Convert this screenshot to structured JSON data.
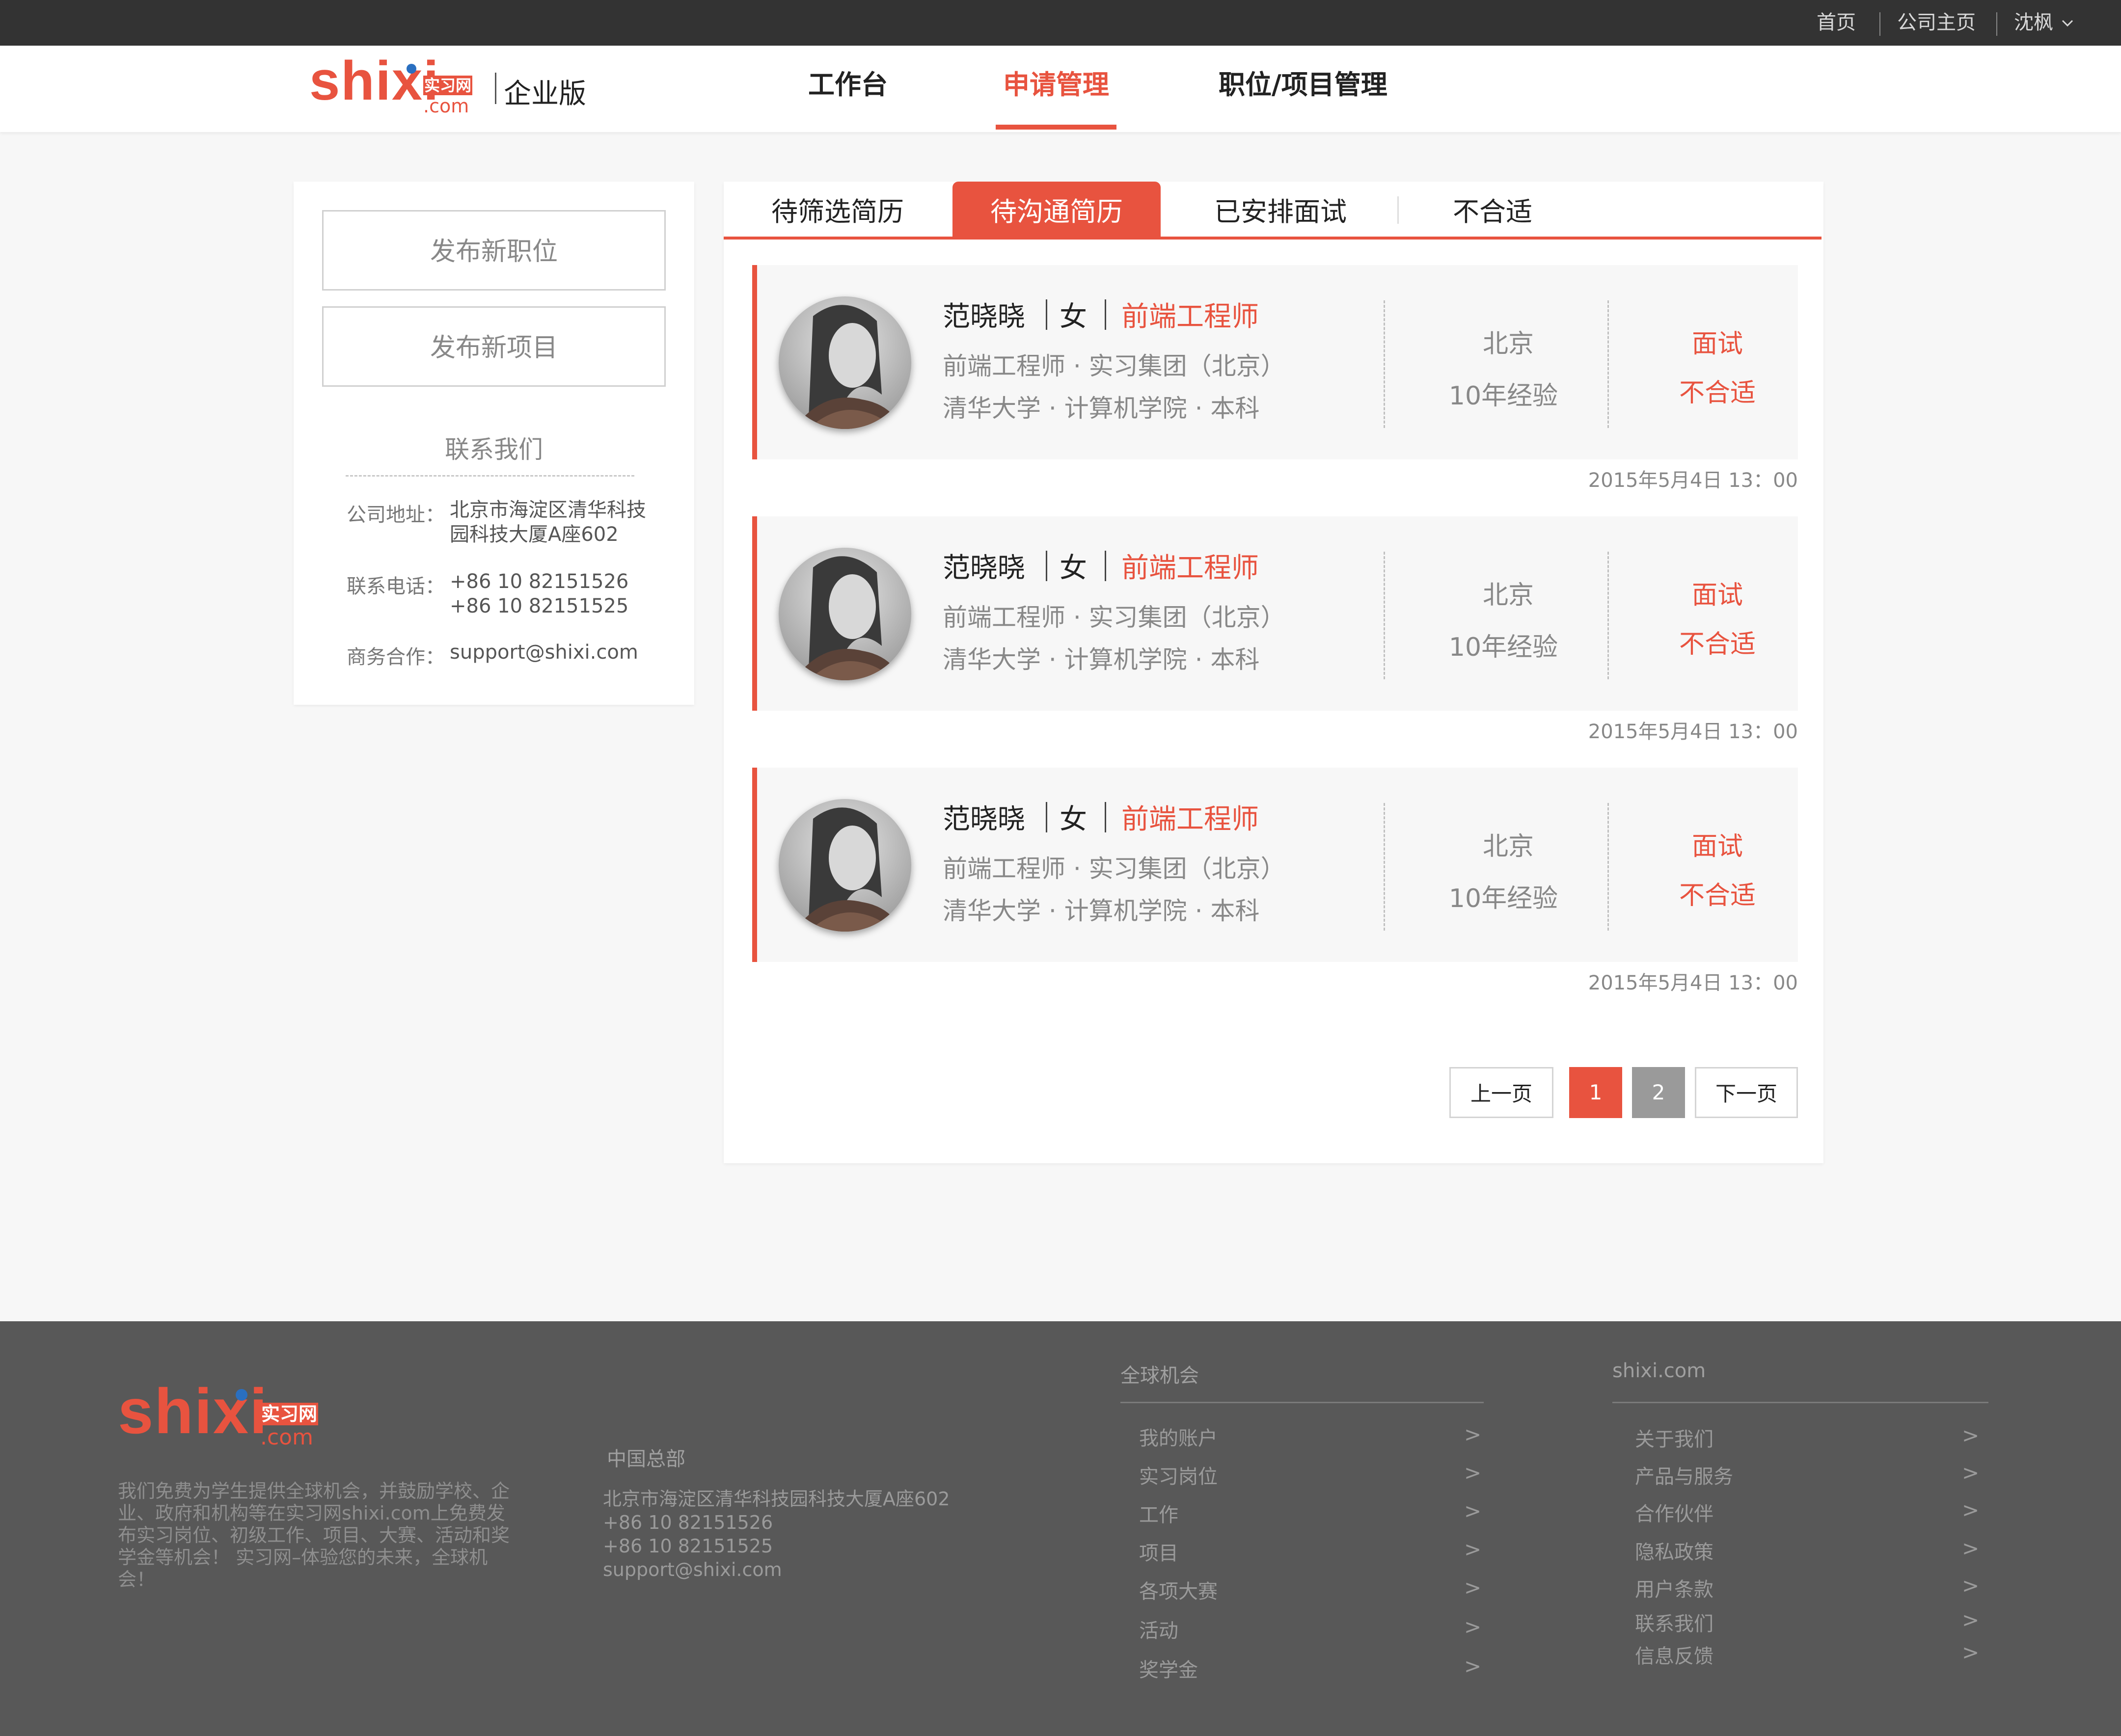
{
  "topbar": {
    "links": [
      "首页",
      "公司主页"
    ],
    "user": "沈枫"
  },
  "header": {
    "logo": {
      "text": "shixi",
      "cn": "实习网",
      "com": ".com"
    },
    "edition": "企业版",
    "nav": [
      {
        "label": "工作台"
      },
      {
        "label": "申请管理",
        "active": true
      },
      {
        "label": "职位/项目管理"
      }
    ]
  },
  "sidebar": {
    "buttons": [
      "发布新职位",
      "发布新项目"
    ],
    "contact_title": "联系我们",
    "contact": [
      {
        "label": "公司地址：",
        "lines": [
          "北京市海淀区清华科技",
          "园科技大厦A座602"
        ]
      },
      {
        "label": "联系电话：",
        "lines": [
          "+86 10 82151526",
          "+86 10 82151525"
        ]
      },
      {
        "label": "商务合作：",
        "lines": [
          "support@shixi.com"
        ]
      }
    ]
  },
  "tabs": [
    {
      "label": "待筛选简历"
    },
    {
      "label": "待沟通简历",
      "active": true
    },
    {
      "label": "已安排面试"
    },
    {
      "label": "不合适"
    }
  ],
  "candidates": [
    {
      "name": "范晓晓",
      "gender": "女",
      "role": "前端工程师",
      "line1": "前端工程师 · 实习集团（北京）",
      "line2": "清华大学 · 计算机学院 · 本科",
      "city": "北京",
      "experience": "10年经验",
      "action_interview": "面试",
      "action_reject": "不合适",
      "date": "2015年5月4日  13：00"
    },
    {
      "name": "范晓晓",
      "gender": "女",
      "role": "前端工程师",
      "line1": "前端工程师 · 实习集团（北京）",
      "line2": "清华大学 · 计算机学院 · 本科",
      "city": "北京",
      "experience": "10年经验",
      "action_interview": "面试",
      "action_reject": "不合适",
      "date": "2015年5月4日  13：00"
    },
    {
      "name": "范晓晓",
      "gender": "女",
      "role": "前端工程师",
      "line1": "前端工程师 · 实习集团（北京）",
      "line2": "清华大学 · 计算机学院 · 本科",
      "city": "北京",
      "experience": "10年经验",
      "action_interview": "面试",
      "action_reject": "不合适",
      "date": "2015年5月4日  13：00"
    }
  ],
  "pagination": {
    "prev": "上一页",
    "pages": [
      "1",
      "2"
    ],
    "current": "1",
    "next": "下一页"
  },
  "footer": {
    "logo": {
      "text": "shixi",
      "cn": "实习网",
      "com": ".com"
    },
    "description": "我们免费为学生提供全球机会，并鼓励学校、企业、政府和机构等在实习网shixi.com上免费发布实习岗位、初级工作、项目、大赛、活动和奖学金等机会！ 实习网–体验您的未来，全球机会！",
    "hq_title": "中国总部",
    "hq_lines": [
      "北京市海淀区清华科技园科技大厦A座602",
      "+86 10 82151526",
      "+86 10 82151525",
      "support@shixi.com"
    ],
    "col1": {
      "title": "全球机会",
      "links": [
        "我的账户",
        "实习岗位",
        "工作",
        "项目",
        "各项大赛",
        "活动",
        "奖学金"
      ]
    },
    "col2": {
      "title": "shixi.com",
      "links": [
        "关于我们",
        "产品与服务",
        "合作伙伴",
        "隐私政策",
        "用户条款",
        "联系我们",
        "信息反馈"
      ]
    },
    "arrow": ">"
  },
  "colors": {
    "accent": "#e8533f",
    "topbar": "#333333",
    "footer": "#585858"
  },
  "icons": {
    "user_dropdown": "chevron-down-icon",
    "avatar": "avatar",
    "link_arrow": "chevron-right-icon"
  }
}
